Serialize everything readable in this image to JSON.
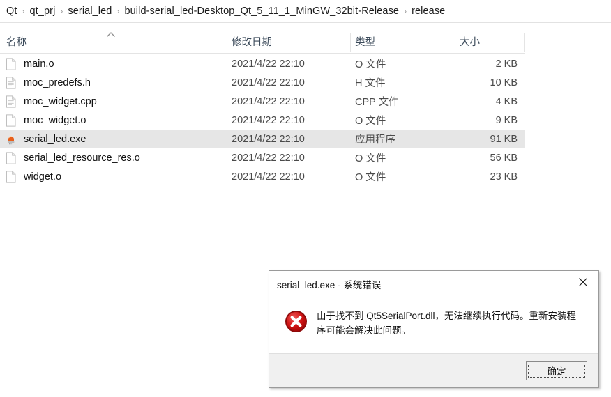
{
  "breadcrumb": {
    "separator": "›",
    "items": [
      {
        "label": "Qt"
      },
      {
        "label": "qt_prj"
      },
      {
        "label": "serial_led"
      },
      {
        "label": "build-serial_led-Desktop_Qt_5_11_1_MinGW_32bit-Release"
      },
      {
        "label": "release"
      }
    ]
  },
  "file_table": {
    "columns": [
      {
        "key": "name",
        "label": "名称"
      },
      {
        "key": "date",
        "label": "修改日期"
      },
      {
        "key": "type",
        "label": "类型"
      },
      {
        "key": "size",
        "label": "大小"
      }
    ],
    "sort": {
      "column": "名称",
      "direction": "ascending",
      "indicator": "∧"
    },
    "rows": [
      {
        "name": "main.o",
        "date": "2021/4/22 22:10",
        "type": "O 文件",
        "size": "2 KB",
        "icon": "blank-file-icon",
        "selected": false
      },
      {
        "name": "moc_predefs.h",
        "date": "2021/4/22 22:10",
        "type": "H 文件",
        "size": "10 KB",
        "icon": "text-file-icon",
        "selected": false
      },
      {
        "name": "moc_widget.cpp",
        "date": "2021/4/22 22:10",
        "type": "CPP 文件",
        "size": "4 KB",
        "icon": "text-file-icon",
        "selected": false
      },
      {
        "name": "moc_widget.o",
        "date": "2021/4/22 22:10",
        "type": "O 文件",
        "size": "9 KB",
        "icon": "blank-file-icon",
        "selected": false
      },
      {
        "name": "serial_led.exe",
        "date": "2021/4/22 22:10",
        "type": "应用程序",
        "size": "91 KB",
        "icon": "led-app-icon",
        "selected": true
      },
      {
        "name": "serial_led_resource_res.o",
        "date": "2021/4/22 22:10",
        "type": "O 文件",
        "size": "56 KB",
        "icon": "blank-file-icon",
        "selected": false
      },
      {
        "name": "widget.o",
        "date": "2021/4/22 22:10",
        "type": "O 文件",
        "size": "23 KB",
        "icon": "blank-file-icon",
        "selected": false
      }
    ]
  },
  "error_dialog": {
    "title": "serial_led.exe - 系统错误",
    "close_icon": "close-icon",
    "icon": "error-circle-icon",
    "message": "由于找不到 Qt5SerialPort.dll，无法继续执行代码。重新安装程序可能会解决此问题。",
    "ok_label": "确定"
  },
  "colors": {
    "selection": "#e6e6e6",
    "header_text": "#3b4a5a",
    "error_red": "#cc0000",
    "dialog_footer": "#f0f0f0",
    "led_orange": "#e8601c"
  }
}
